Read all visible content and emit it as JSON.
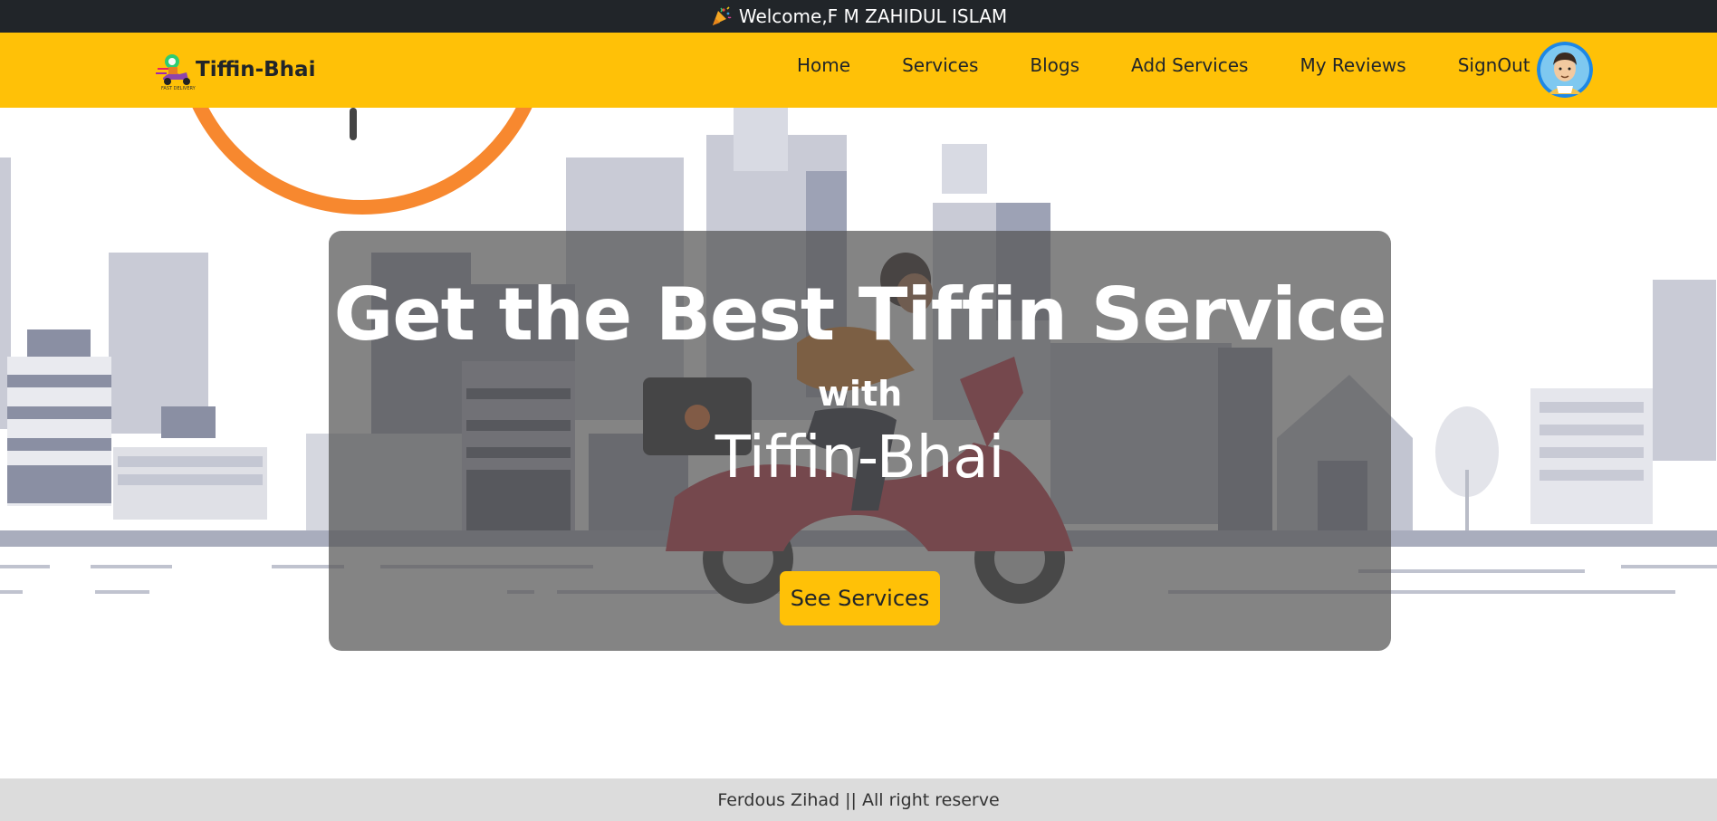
{
  "topbar": {
    "welcome_text": "Welcome,F M ZAHIDUL ISLAM",
    "icon": "party-popper-icon"
  },
  "navbar": {
    "brand_name": "Tiffin-Bhai",
    "logo_icon": "delivery-scooter-logo",
    "links": [
      "Home",
      "Services",
      "Blogs",
      "Add Services",
      "My Reviews",
      "SignOut"
    ],
    "avatar_icon": "user-avatar"
  },
  "hero": {
    "title": "Get the Best Tiffin Service",
    "subtitle": "with",
    "brand": "Tiffin-Bhai",
    "cta_label": "See Services"
  },
  "footer": {
    "text": "Ferdous Zihad || All right reserve"
  },
  "colors": {
    "accent": "#ffc107",
    "topbar": "#212529",
    "footer": "#dcdcdc"
  }
}
